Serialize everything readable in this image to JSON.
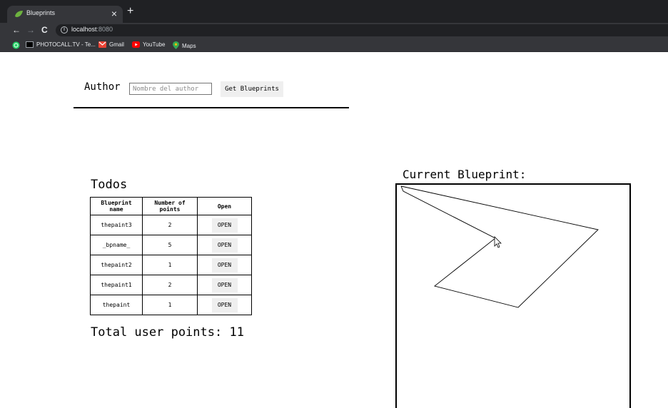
{
  "browser": {
    "tab": {
      "title": "Blueprints",
      "close": "×"
    },
    "new_tab": "+",
    "nav": {
      "back": "←",
      "forward": "→",
      "reload": "C"
    },
    "url": {
      "host": "localhost",
      "port": ":8080"
    },
    "bookmarks": [
      {
        "label": "PHOTOCALL.TV - Te...",
        "icon": "photocall-icon"
      },
      {
        "label": "Gmail",
        "icon": "gmail-icon"
      },
      {
        "label": "YouTube",
        "icon": "youtube-icon"
      },
      {
        "label": "Maps",
        "icon": "maps-icon"
      }
    ]
  },
  "page": {
    "author_label": "Author",
    "author_input": {
      "placeholder": "Nombre del author",
      "value": ""
    },
    "get_button": "Get Blueprints",
    "selected_author": "Todos",
    "table": {
      "headers": [
        "Blueprint name",
        "Number of points",
        "Open"
      ],
      "rows": [
        {
          "name": "thepaint3",
          "points": "2",
          "action": "OPEN"
        },
        {
          "name": "_bpname_",
          "points": "5",
          "action": "OPEN"
        },
        {
          "name": "thepaint2",
          "points": "1",
          "action": "OPEN"
        },
        {
          "name": "thepaint1",
          "points": "2",
          "action": "OPEN"
        },
        {
          "name": "thepaint",
          "points": "1",
          "action": "OPEN"
        }
      ]
    },
    "total_points": "Total user points: 11",
    "current_blueprint_title": "Current Blueprint:"
  },
  "colors": {
    "chrome_dark": "#202124",
    "chrome_mid": "#35363a",
    "button_gray": "#efefef"
  }
}
